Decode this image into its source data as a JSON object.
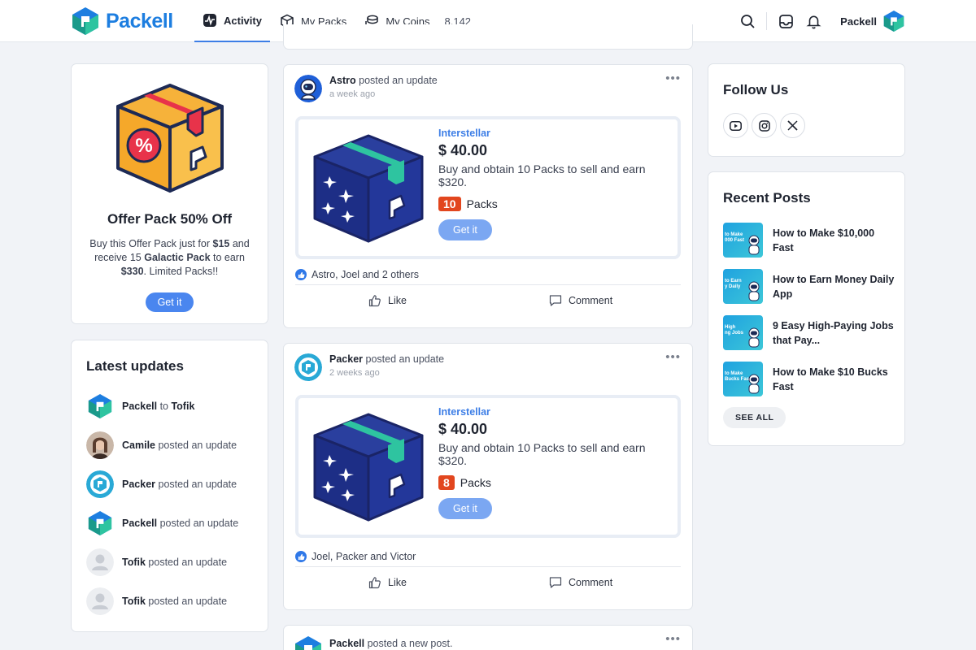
{
  "brand": {
    "name": "Packell"
  },
  "nav": {
    "items": [
      {
        "label": "Activity",
        "icon": "activity-icon",
        "active": true
      },
      {
        "label": "My Packs",
        "icon": "box-icon",
        "active": false
      },
      {
        "label": "My Coins",
        "icon": "coins-icon",
        "active": false
      }
    ],
    "coin_count": "8,142"
  },
  "header": {
    "user_name": "Packell"
  },
  "offer": {
    "title": "Offer Pack 50% Off",
    "text_1": "Buy this Offer Pack just for ",
    "price": "$15",
    "text_2": " and receive 15 ",
    "pack_name": "Galactic Pack",
    "text_3": " to earn ",
    "earn": "$330",
    "text_4": ". Limited Packs!!",
    "button": "Get it"
  },
  "latest_updates": {
    "title": "Latest updates",
    "items": [
      {
        "name": "Packell",
        "middle": " to ",
        "target": "Tofik",
        "action": "",
        "avatar": "packell-logo-icon"
      },
      {
        "name": "Camile",
        "middle": "",
        "target": "",
        "action": " posted an update",
        "avatar": "user-photo"
      },
      {
        "name": "Packer",
        "middle": "",
        "target": "",
        "action": " posted an update",
        "avatar": "packer-logo-icon"
      },
      {
        "name": "Packell",
        "middle": "",
        "target": "",
        "action": " posted an update",
        "avatar": "packell-logo-icon"
      },
      {
        "name": "Tofik",
        "middle": "",
        "target": "",
        "action": " posted an update",
        "avatar": "default-user-icon"
      },
      {
        "name": "Tofik",
        "middle": "",
        "target": "",
        "action": " posted an update",
        "avatar": "default-user-icon"
      }
    ]
  },
  "posts": [
    {
      "author": "Astro",
      "action": " posted an update",
      "time": "a week ago",
      "product": {
        "category": "Interstellar",
        "price": "$ 40.00",
        "description": "Buy and obtain 10 Packs to sell and earn $320.",
        "packs_count": "10",
        "packs_label": "Packs",
        "button": "Get it"
      },
      "likes": "Astro, Joel and 2 others",
      "like_label": "Like",
      "comment_label": "Comment"
    },
    {
      "author": "Packer",
      "action": " posted an update",
      "time": "2 weeks ago",
      "product": {
        "category": "Interstellar",
        "price": "$ 40.00",
        "description": "Buy and obtain 10 Packs to sell and earn $320.",
        "packs_count": "8",
        "packs_label": "Packs",
        "button": "Get it"
      },
      "likes": "Joel, Packer and Victor",
      "like_label": "Like",
      "comment_label": "Comment"
    },
    {
      "author": "Packell",
      "action": " posted a new post."
    }
  ],
  "follow": {
    "title": "Follow Us",
    "networks": [
      "youtube-icon",
      "instagram-icon",
      "x-icon"
    ]
  },
  "recent_posts": {
    "title": "Recent Posts",
    "items": [
      {
        "title": "How to Make $10,000 Fast",
        "thumb": "to Make\n000 Fast"
      },
      {
        "title": "How to Earn Money Daily App",
        "thumb": "to Earn\ny Daily"
      },
      {
        "title": "9 Easy High-Paying Jobs that Pay...",
        "thumb": "High\nng Jobs"
      },
      {
        "title": "How to Make $10 Bucks Fast",
        "thumb": "to Make\nBucks Fast"
      }
    ],
    "see_all": "SEE ALL"
  },
  "colors": {
    "accent": "#3d7ee6",
    "badge": "#e2461e",
    "brand": "#1d7ee0",
    "teal": "#2ec4a0"
  }
}
